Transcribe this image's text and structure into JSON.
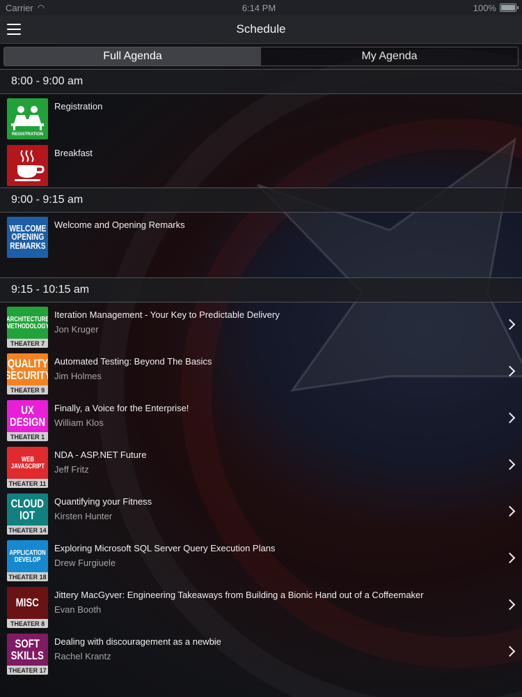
{
  "status_bar": {
    "carrier": "Carrier",
    "time": "6:14 PM",
    "battery": "100%"
  },
  "nav": {
    "title": "Schedule"
  },
  "tabs": {
    "full": "Full Agenda",
    "mine": "My Agenda"
  },
  "sections": [
    {
      "time": "8:00 - 9:00 am",
      "items": [
        {
          "title": "Registration",
          "speaker": "",
          "icon": "registration-icon",
          "color": "#21a238"
        },
        {
          "title": "Breakfast",
          "speaker": "",
          "icon": "coffee-cup-icon",
          "color": "#b4161b"
        }
      ]
    },
    {
      "time": "9:00 - 9:15 am",
      "items": [
        {
          "title": "Welcome and Opening Remarks",
          "speaker": "",
          "badge": "WELCOME\nOPENING\nREMARKS",
          "color": "#1c5fa8"
        }
      ]
    },
    {
      "time": "9:15 - 10:15 am",
      "items": [
        {
          "title": "Iteration Management - Your Key to Predictable Delivery",
          "speaker": "Jon Kruger",
          "badge": "ARCHITECTURE\nMETHODOLOGY",
          "theater": "THEATER 7",
          "color": "#22a33a"
        },
        {
          "title": "Automated Testing: Beyond The Basics",
          "speaker": "Jim Holmes",
          "badge": "QUALITY\nSECURITY",
          "theater": "THEATER 9",
          "color": "#f48220"
        },
        {
          "title": "Finally, a Voice for the Enterprise!",
          "speaker": "William Klos",
          "badge": "UX\nDESIGN",
          "theater": "THEATER 1",
          "color": "#e81ed8"
        },
        {
          "title": "NDA - ASP.NET Future",
          "speaker": "Jeff Fritz",
          "badge": "WEB\nJAVASCRIPT",
          "theater": "THEATER 11",
          "color": "#e02a2e"
        },
        {
          "title": "Quantifying your Fitness",
          "speaker": "Kirsten Hunter",
          "badge": "CLOUD\nIOT",
          "theater": "THEATER 14",
          "color": "#11817f"
        },
        {
          "title": "Exploring Microsoft SQL Server Query Execution Plans",
          "speaker": "Drew Furgiuele",
          "badge": "APPLICATION\nDEVELOP",
          "theater": "THEATER 18",
          "color": "#1688d0"
        },
        {
          "title": "Jittery MacGyver: Engineering Takeaways from Building a Bionic Hand out of a Coffeemaker",
          "speaker": "Evan Booth",
          "badge": "MISC",
          "theater": "THEATER 8",
          "color": "#6b1214"
        },
        {
          "title": "Dealing with discouragement as a newbie",
          "speaker": "Rachel Krantz",
          "badge": "SOFT\nSKILLS",
          "theater": "THEATER 17",
          "color": "#7f1a63"
        }
      ]
    }
  ]
}
